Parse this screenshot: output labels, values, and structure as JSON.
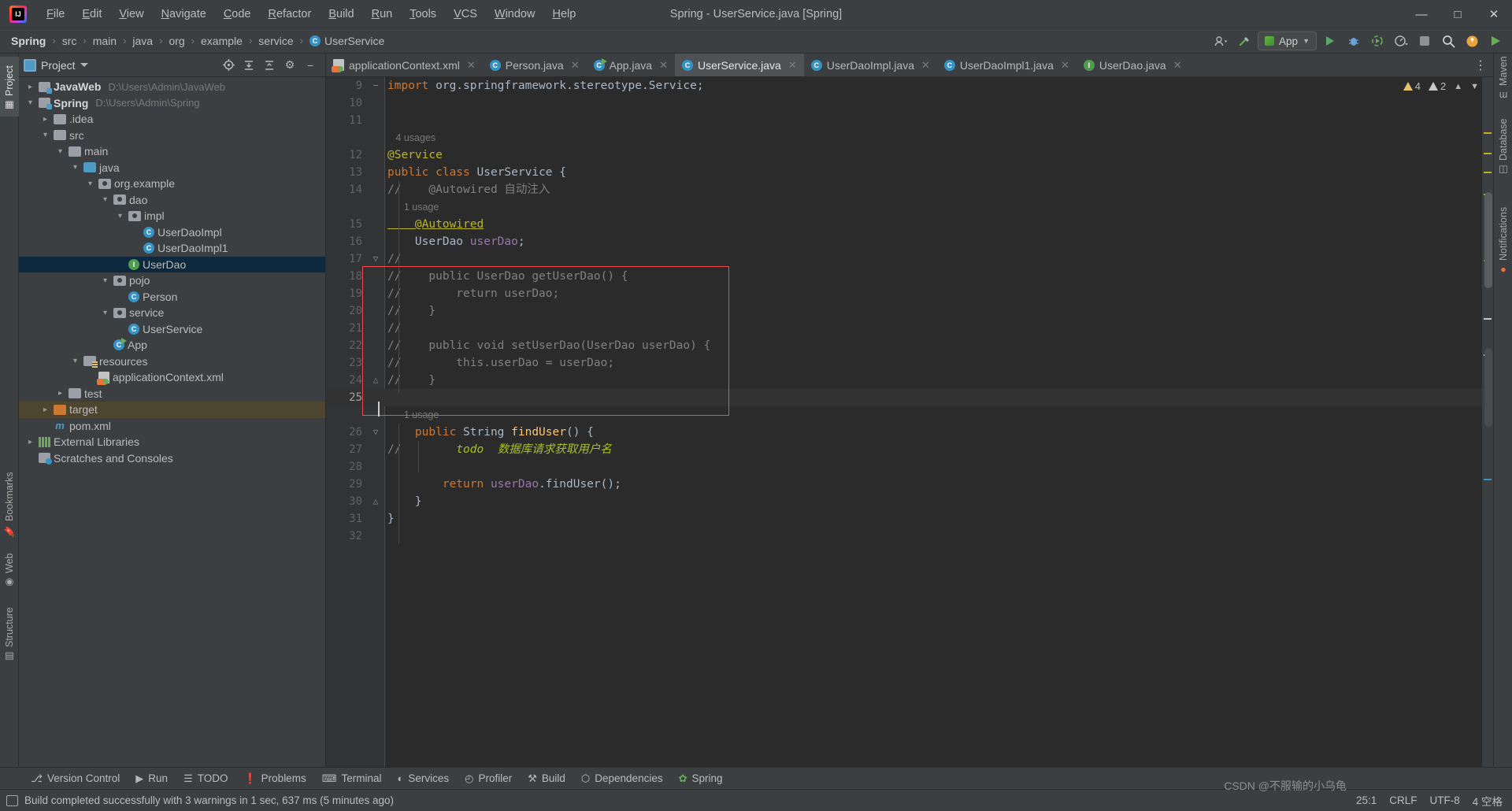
{
  "window": {
    "title": "Spring - UserService.java [Spring]",
    "logo_icon": "intellij-idea-logo",
    "minimize_label": "—",
    "maximize_label": "□",
    "close_label": "✕"
  },
  "menu": [
    {
      "label": "File"
    },
    {
      "label": "Edit"
    },
    {
      "label": "View"
    },
    {
      "label": "Navigate"
    },
    {
      "label": "Code"
    },
    {
      "label": "Refactor"
    },
    {
      "label": "Build"
    },
    {
      "label": "Run"
    },
    {
      "label": "Tools"
    },
    {
      "label": "VCS"
    },
    {
      "label": "Window"
    },
    {
      "label": "Help"
    }
  ],
  "breadcrumb": {
    "items": [
      {
        "label": "Spring",
        "bold": true
      },
      {
        "label": "src"
      },
      {
        "label": "main"
      },
      {
        "label": "java"
      },
      {
        "label": "org"
      },
      {
        "label": "example"
      },
      {
        "label": "service"
      },
      {
        "label": "UserService",
        "icon": "class-icon"
      }
    ],
    "separator": "›"
  },
  "navbar_right": {
    "profile_icon": "user-avatar-icon",
    "hammer_icon": "build-hammer-icon",
    "run_config": "App",
    "run_icon": "run-icon",
    "debug_icon": "debug-icon",
    "coverage_icon": "run-with-coverage-icon",
    "profiler_icon": "profiler-icon",
    "stop_icon": "stop-icon",
    "search_icon": "search-everywhere-icon",
    "updates_icon": "updates-icon",
    "ide_run_icon": "ide-run-icon"
  },
  "left_strip": [
    {
      "label": "Project",
      "selected": true,
      "icon": "project-icon"
    },
    {
      "label": "Bookmarks",
      "icon": "bookmarks-icon"
    },
    {
      "label": "Web",
      "icon": "web-icon"
    },
    {
      "label": "Structure",
      "icon": "structure-icon"
    }
  ],
  "right_strip": [
    {
      "label": "Maven",
      "icon": "maven-icon"
    },
    {
      "label": "Database",
      "icon": "database-icon"
    },
    {
      "label": "Notifications",
      "icon": "notifications-icon"
    }
  ],
  "project_panel": {
    "title": "Project",
    "actions": [
      "locate-icon",
      "expand-all-icon",
      "collapse-all-icon",
      "settings-gear-icon",
      "hide-icon"
    ],
    "tree": [
      {
        "label": "JavaWeb",
        "path": "D:\\Users\\Admin\\JavaWeb",
        "indent": 0,
        "arrow": "closed",
        "icon": "module-icon",
        "bold": true
      },
      {
        "label": "Spring",
        "path": "D:\\Users\\Admin\\Spring",
        "indent": 0,
        "arrow": "open",
        "icon": "module-icon",
        "bold": true
      },
      {
        "label": ".idea",
        "path": "",
        "indent": 1,
        "arrow": "closed",
        "icon": "folder-gray-icon"
      },
      {
        "label": "src",
        "path": "",
        "indent": 1,
        "arrow": "open",
        "icon": "folder-gray-icon"
      },
      {
        "label": "main",
        "path": "",
        "indent": 2,
        "arrow": "open",
        "icon": "folder-gray-icon"
      },
      {
        "label": "java",
        "path": "",
        "indent": 3,
        "arrow": "open",
        "icon": "source-root-icon"
      },
      {
        "label": "org.example",
        "path": "",
        "indent": 4,
        "arrow": "open",
        "icon": "package-icon"
      },
      {
        "label": "dao",
        "path": "",
        "indent": 5,
        "arrow": "open",
        "icon": "package-icon"
      },
      {
        "label": "impl",
        "path": "",
        "indent": 6,
        "arrow": "open",
        "icon": "package-icon"
      },
      {
        "label": "UserDaoImpl",
        "path": "",
        "indent": 7,
        "arrow": "none",
        "icon": "class-icon"
      },
      {
        "label": "UserDaoImpl1",
        "path": "",
        "indent": 7,
        "arrow": "none",
        "icon": "class-icon"
      },
      {
        "label": "UserDao",
        "path": "",
        "indent": 6,
        "arrow": "none",
        "icon": "interface-icon",
        "selected": true
      },
      {
        "label": "pojo",
        "path": "",
        "indent": 5,
        "arrow": "open",
        "icon": "package-icon"
      },
      {
        "label": "Person",
        "path": "",
        "indent": 6,
        "arrow": "none",
        "icon": "class-icon"
      },
      {
        "label": "service",
        "path": "",
        "indent": 5,
        "arrow": "open",
        "icon": "package-icon"
      },
      {
        "label": "UserService",
        "path": "",
        "indent": 6,
        "arrow": "none",
        "icon": "class-icon"
      },
      {
        "label": "App",
        "path": "",
        "indent": 5,
        "arrow": "none",
        "icon": "runnable-class-icon"
      },
      {
        "label": "resources",
        "path": "",
        "indent": 3,
        "arrow": "open",
        "icon": "resource-root-icon"
      },
      {
        "label": "applicationContext.xml",
        "path": "",
        "indent": 4,
        "arrow": "none",
        "icon": "spring-xml-icon"
      },
      {
        "label": "test",
        "path": "",
        "indent": 2,
        "arrow": "closed",
        "icon": "folder-gray-icon"
      },
      {
        "label": "target",
        "path": "",
        "indent": 1,
        "arrow": "closed",
        "icon": "folder-orange-icon",
        "highlighted": true
      },
      {
        "label": "pom.xml",
        "path": "",
        "indent": 1,
        "arrow": "none",
        "icon": "maven-pom-icon"
      },
      {
        "label": "External Libraries",
        "path": "",
        "indent": 0,
        "arrow": "closed",
        "icon": "libraries-icon"
      },
      {
        "label": "Scratches and Consoles",
        "path": "",
        "indent": 0,
        "arrow": "none",
        "icon": "scratches-icon"
      }
    ]
  },
  "tabs": [
    {
      "label": "applicationContext.xml",
      "icon": "spring-xml-icon",
      "active": false
    },
    {
      "label": "Person.java",
      "icon": "class-icon",
      "active": false
    },
    {
      "label": "App.java",
      "icon": "runnable-class-icon",
      "active": false
    },
    {
      "label": "UserService.java",
      "icon": "class-icon",
      "active": true
    },
    {
      "label": "UserDaoImpl.java",
      "icon": "class-icon",
      "active": false
    },
    {
      "label": "UserDaoImpl1.java",
      "icon": "class-icon",
      "active": false
    },
    {
      "label": "UserDao.java",
      "icon": "interface-icon",
      "active": false
    }
  ],
  "tabbar_overflow_icon": "more-tabs-icon",
  "inspection": {
    "warning_count": "4",
    "weak_warning_count": "2",
    "warning_icon": "warning-triangle-icon",
    "weak_warning_icon": "weak-warning-triangle-icon",
    "chevron_down_icon": "chevron-down-icon",
    "chevron_up_icon": "chevron-up-icon"
  },
  "editor": {
    "file": "UserService.java",
    "caret_line": 25,
    "lines": [
      {
        "num": "9",
        "fold": "−",
        "segments": [
          {
            "t": "import ",
            "c": "kw"
          },
          {
            "t": "org.springframework.stereotype.",
            "c": "pln"
          },
          {
            "t": "Service",
            "c": "typ"
          },
          {
            "t": ";",
            "c": "pln"
          }
        ]
      },
      {
        "num": "10",
        "fold": "",
        "segments": []
      },
      {
        "num": "11",
        "fold": "",
        "segments": []
      },
      {
        "hint": "4 usages"
      },
      {
        "num": "12",
        "fold": "",
        "segments": [
          {
            "t": "@Service",
            "c": "ann"
          }
        ]
      },
      {
        "num": "13",
        "fold": "",
        "segments": [
          {
            "t": "public class ",
            "c": "kw"
          },
          {
            "t": "UserService",
            "c": "typ"
          },
          {
            "t": " {",
            "c": "pln"
          }
        ]
      },
      {
        "num": "14",
        "fold": "",
        "segments": [
          {
            "t": "//    @Autowired 自动注入",
            "c": "cmt"
          }
        ]
      },
      {
        "hint": "1 usage",
        "indent": 1
      },
      {
        "num": "15",
        "fold": "",
        "segments": [
          {
            "t": "    @Autowired",
            "c": "ann under"
          }
        ]
      },
      {
        "num": "16",
        "fold": "",
        "segments": [
          {
            "t": "    UserDao ",
            "c": "typ"
          },
          {
            "t": "userDao",
            "c": "fld2"
          },
          {
            "t": ";",
            "c": "pln"
          }
        ]
      },
      {
        "num": "17",
        "fold": "▽",
        "segments": [
          {
            "t": "//",
            "c": "cmt"
          }
        ]
      },
      {
        "num": "18",
        "fold": "",
        "segments": [
          {
            "t": "//    public UserDao getUserDao() {",
            "c": "cmt"
          }
        ]
      },
      {
        "num": "19",
        "fold": "",
        "segments": [
          {
            "t": "//        return userDao;",
            "c": "cmt"
          }
        ]
      },
      {
        "num": "20",
        "fold": "",
        "segments": [
          {
            "t": "//    }",
            "c": "cmt"
          }
        ]
      },
      {
        "num": "21",
        "fold": "",
        "segments": [
          {
            "t": "//",
            "c": "cmt"
          }
        ]
      },
      {
        "num": "22",
        "fold": "",
        "segments": [
          {
            "t": "//    public void setUserDao(UserDao userDao) {",
            "c": "cmt"
          }
        ]
      },
      {
        "num": "23",
        "fold": "",
        "segments": [
          {
            "t": "//        this.userDao = userDao;",
            "c": "cmt"
          }
        ]
      },
      {
        "num": "24",
        "fold": "△",
        "segments": [
          {
            "t": "//    }",
            "c": "cmt"
          }
        ]
      },
      {
        "num": "25",
        "fold": "",
        "segments": [],
        "current": true
      },
      {
        "hint": "1 usage",
        "indent": 1
      },
      {
        "num": "26",
        "fold": "▽",
        "segments": [
          {
            "t": "    public ",
            "c": "kw"
          },
          {
            "t": "String ",
            "c": "typ"
          },
          {
            "t": "findUser",
            "c": "fn"
          },
          {
            "t": "() {",
            "c": "pln"
          }
        ]
      },
      {
        "num": "27",
        "fold": "",
        "segments": [
          {
            "t": "//        ",
            "c": "cmt"
          },
          {
            "t": "todo",
            "c": "todo"
          },
          {
            "t": "  数据库请求获取用户名",
            "c": "todo"
          }
        ]
      },
      {
        "num": "28",
        "fold": "",
        "segments": []
      },
      {
        "num": "29",
        "fold": "",
        "segments": [
          {
            "t": "        return ",
            "c": "kw"
          },
          {
            "t": "userDao",
            "c": "fld2"
          },
          {
            "t": ".",
            "c": "pln"
          },
          {
            "t": "findUser",
            "c": "pln"
          },
          {
            "t": "();",
            "c": "pln"
          }
        ]
      },
      {
        "num": "30",
        "fold": "△",
        "segments": [
          {
            "t": "    }",
            "c": "pln"
          }
        ]
      },
      {
        "num": "31",
        "fold": "",
        "segments": [
          {
            "t": "}",
            "c": "pln"
          }
        ]
      },
      {
        "num": "32",
        "fold": "",
        "segments": []
      }
    ],
    "annotation_box_color": "#f24b4b"
  },
  "tool_windows": [
    {
      "label": "Version Control",
      "icon": "version-control-icon"
    },
    {
      "label": "Run",
      "icon": "run-icon"
    },
    {
      "label": "TODO",
      "icon": "todo-icon"
    },
    {
      "label": "Problems",
      "icon": "problems-icon"
    },
    {
      "label": "Terminal",
      "icon": "terminal-icon"
    },
    {
      "label": "Services",
      "icon": "services-icon"
    },
    {
      "label": "Profiler",
      "icon": "profiler-icon"
    },
    {
      "label": "Build",
      "icon": "build-icon"
    },
    {
      "label": "Dependencies",
      "icon": "dependencies-icon"
    },
    {
      "label": "Spring",
      "icon": "spring-icon"
    }
  ],
  "status_bar": {
    "message": "Build completed successfully with 3 warnings in 1 sec, 637 ms (5 minutes ago)",
    "message_icon": "build-status-icon",
    "position": "25:1",
    "line_separator": "CRLF",
    "encoding": "UTF-8",
    "indent": "4 空格",
    "watermark": "CSDN @不服输的小乌龟"
  },
  "zoom_popup": {
    "icon": "editor-preview-icon",
    "chevron": "▸"
  },
  "colors": {
    "accent_blue": "#3592c4",
    "selection": "#0d293e",
    "annotation_red": "#f24b4b",
    "keyword": "#cc7832",
    "annotation_yellow": "#bbb529",
    "string_green": "#6a8759",
    "field_purple": "#9876aa",
    "method_gold": "#ffc66d",
    "comment_gray": "#808080"
  }
}
